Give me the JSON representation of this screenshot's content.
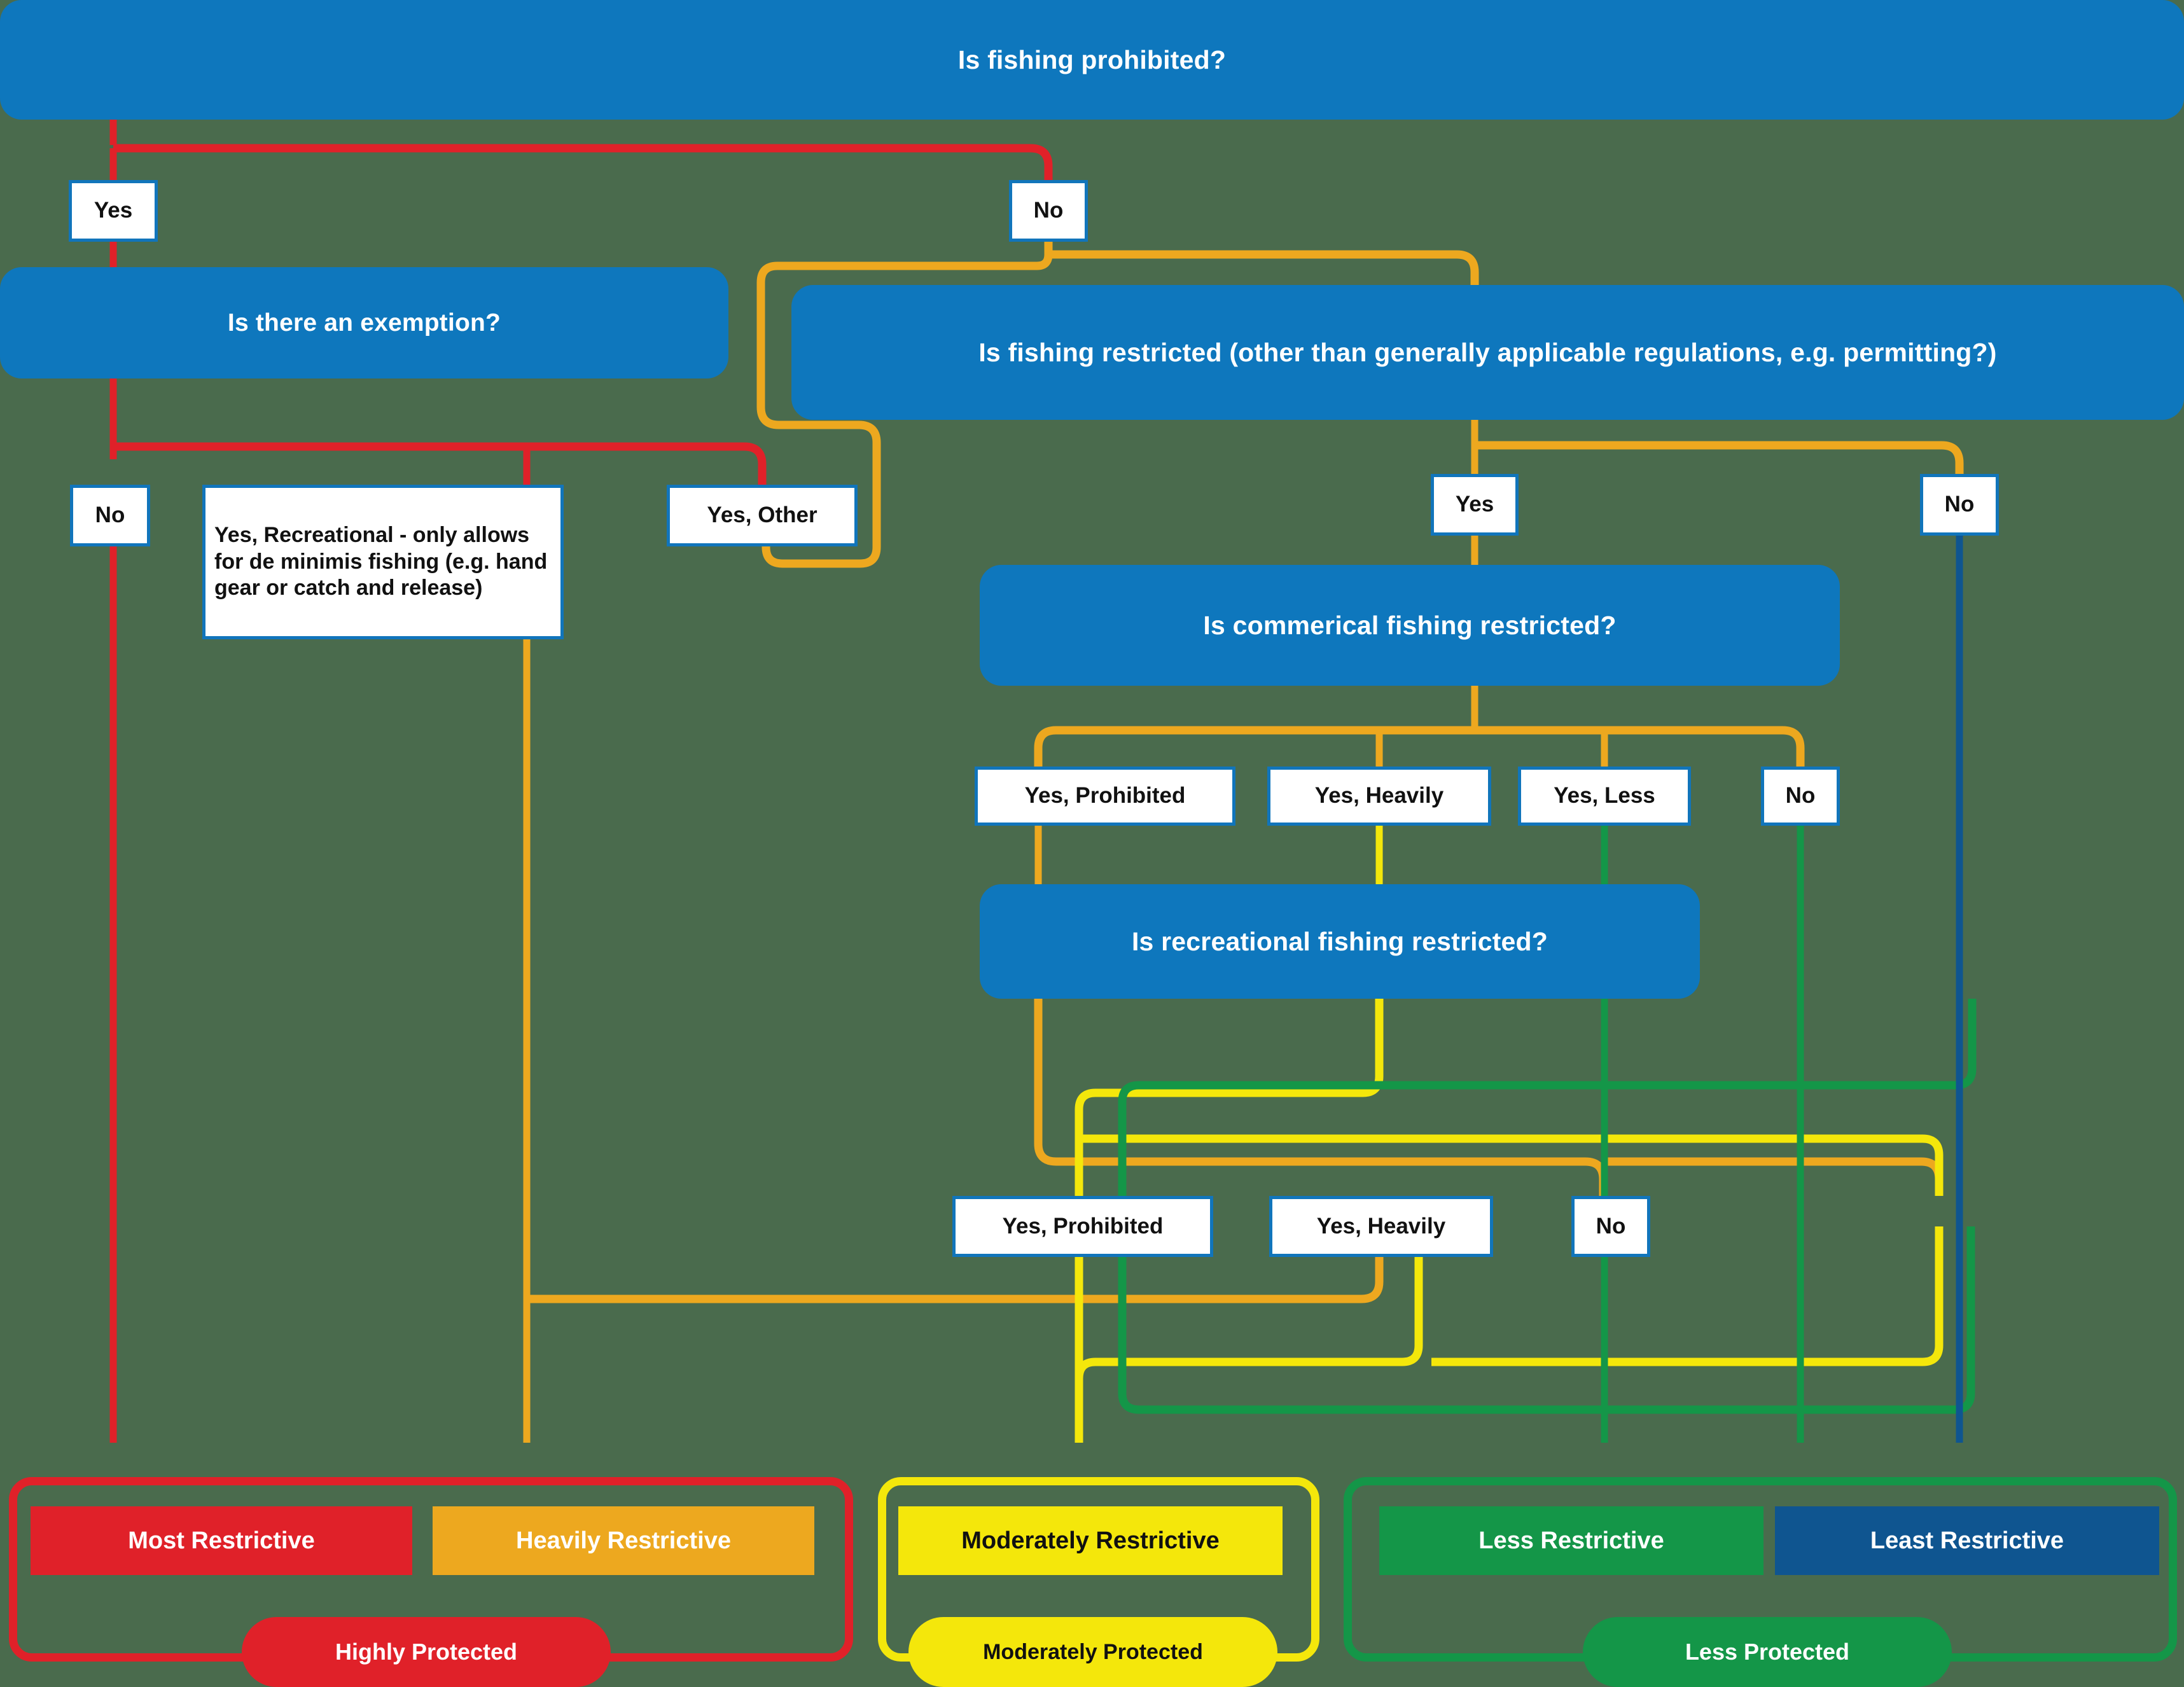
{
  "diagram": {
    "title": "Fishing restriction classification flowchart",
    "background_color": "#4a6b4d"
  },
  "palette": {
    "blue_node": "#0E77BD",
    "blue_border": "#1175BB",
    "red": "#E02129",
    "orange": "#EDA81F",
    "yellow": "#F4E70B",
    "green": "#149648",
    "dark_blue": "#0F5590",
    "white": "#FFFFFF"
  },
  "questions": {
    "q1": "Is fishing prohibited?",
    "q2": "Is there an exemption?",
    "q3": "Is fishing restricted (other than generally applicable regulations, e.g. permitting?)",
    "q4": "Is commerical fishing restricted?",
    "q5": "Is recreational fishing restricted?"
  },
  "answers": {
    "q1_yes": "Yes",
    "q1_no": "No",
    "q2_no": "No",
    "q2_yes_rec": "Yes, Recreational - only allows for de minimis fishing  (e.g. hand gear or  catch and release)",
    "q2_yes_other": "Yes, Other",
    "q3_yes": "Yes",
    "q3_no": "No",
    "q4_prohibited": "Yes, Prohibited",
    "q4_heavily": "Yes, Heavily",
    "q4_less": "Yes, Less",
    "q4_no": "No",
    "q5_prohibited": "Yes, Prohibited",
    "q5_heavily": "Yes, Heavily",
    "q5_no": "No"
  },
  "outcomes": {
    "most": "Most Restrictive",
    "heavily": "Heavily Restrictive",
    "moderately": "Moderately Restrictive",
    "less": "Less Restrictive",
    "least": "Least Restrictive"
  },
  "groups": {
    "highly_protected": "Highly Protected",
    "moderately_protected": "Moderately Protected",
    "less_protected": "Less Protected"
  }
}
